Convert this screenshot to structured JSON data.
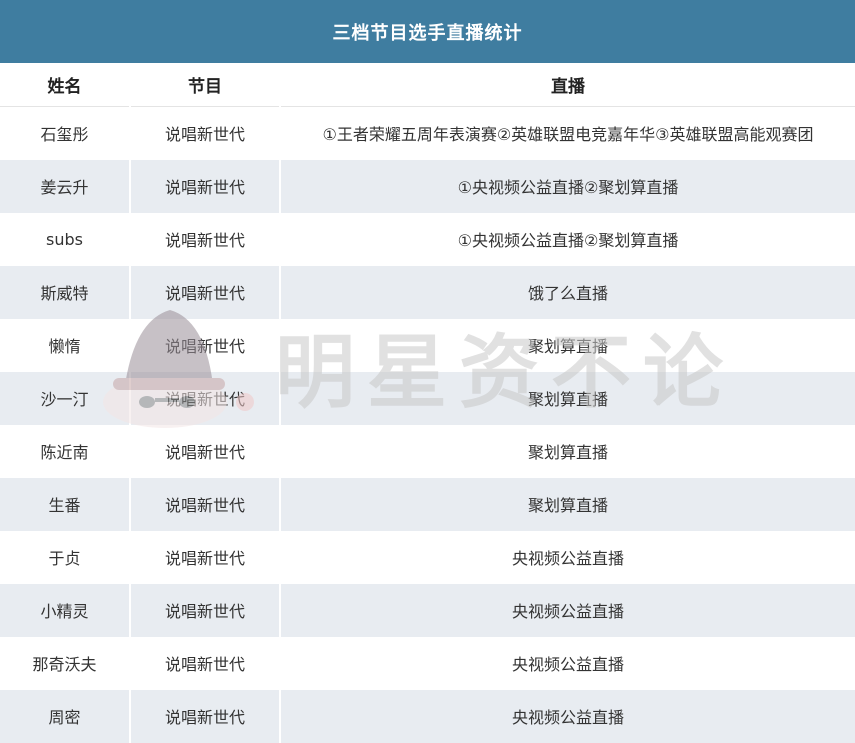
{
  "title": "三档节目选手直播统计",
  "headers": [
    "姓名",
    "节目",
    "直播"
  ],
  "rows": [
    [
      "石玺彤",
      "说唱新世代",
      "①王者荣耀五周年表演赛②英雄联盟电竞嘉年华③英雄联盟高能观赛团"
    ],
    [
      "姜云升",
      "说唱新世代",
      "①央视频公益直播②聚划算直播"
    ],
    [
      "subs",
      "说唱新世代",
      "①央视频公益直播②聚划算直播"
    ],
    [
      "斯威特",
      "说唱新世代",
      "饿了么直播"
    ],
    [
      "懒惰",
      "说唱新世代",
      "聚划算直播"
    ],
    [
      "沙一汀",
      "说唱新世代",
      "聚划算直播"
    ],
    [
      "陈近南",
      "说唱新世代",
      "聚划算直播"
    ],
    [
      "生番",
      "说唱新世代",
      "聚划算直播"
    ],
    [
      "于贞",
      "说唱新世代",
      "央视频公益直播"
    ],
    [
      "小精灵",
      "说唱新世代",
      "央视频公益直播"
    ],
    [
      "那奇沃夫",
      "说唱新世代",
      "央视频公益直播"
    ],
    [
      "周密",
      "说唱新世代",
      "央视频公益直播"
    ]
  ],
  "watermark": {
    "text": "明星资不论",
    "icon": "hat-mascot-icon"
  },
  "colors": {
    "title_bg": "#3f7da0",
    "stripe": "#e8ecf1"
  }
}
